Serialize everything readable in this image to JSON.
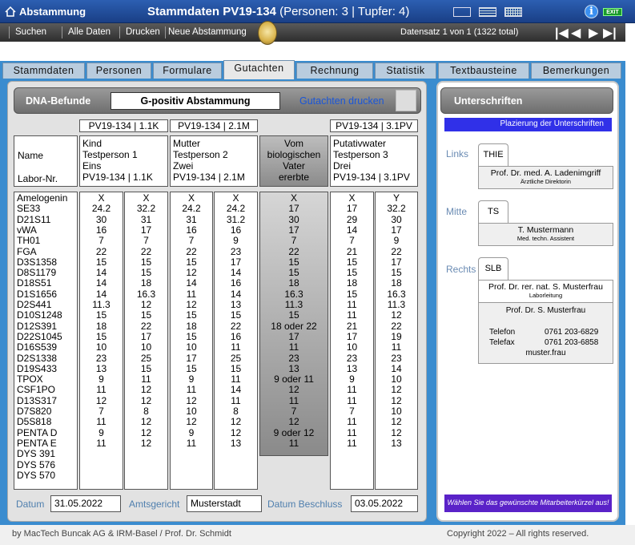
{
  "titlebar": {
    "home_label": "Abstammung",
    "title": "Stammdaten PV19-134",
    "subtitle": "(Personen: 3  |  Tupfer: 4)",
    "exit": "EXIT",
    "info": "i"
  },
  "toolbar": {
    "suchen": "Suchen",
    "alle": "Alle Daten",
    "drucken": "Drucken",
    "neu": "Neue Abstammung",
    "record": "Datensatz 1 von 1 (1322 total)"
  },
  "tabs": [
    "Stammdaten",
    "Personen",
    "Formulare",
    "Gutachten",
    "Rechnung",
    "Statistik",
    "Textbausteine",
    "Bemerkungen"
  ],
  "dna": {
    "label": "DNA-Befunde",
    "value": "G-positiv Abstammung",
    "print": "Gutachten drucken"
  },
  "refs": {
    "kind": "PV19-134 | 1.1K",
    "mutter": "PV19-134 | 2.1M",
    "putativ": "PV19-134 | 3.1PV"
  },
  "heads": {
    "name_lbl": "Name",
    "labor_lbl": "Labor-Nr.",
    "kind": [
      "Kind",
      "Testperson 1",
      "Eins",
      "PV19-134 | 1.1K"
    ],
    "mutter": [
      "Mutter",
      "Testperson 2",
      "Zwei",
      "PV19-134 | 2.1M"
    ],
    "vater": [
      "Vom",
      "biologischen",
      "Vater",
      "ererbte"
    ],
    "putativ": [
      "Putativwater",
      "Testperson 3",
      "Drei",
      "PV19-134 | 3.1PV"
    ]
  },
  "loci": [
    "Amelogenin",
    "SE33",
    "D21S11",
    "vWA",
    "TH01",
    "FGA",
    "D3S1358",
    "D8S1179",
    "D18S51",
    "D1S1656",
    "D2S441",
    "D10S1248",
    "D12S391",
    "D22S1045",
    "D16S539",
    "D2S1338",
    "D19S433",
    "TPOX",
    "CSF1PO",
    "D13S317",
    "D7S820",
    "D5S818",
    "PENTA D",
    "PENTA E",
    "DYS 391",
    "DYS 576",
    "DYS 570"
  ],
  "kind1": [
    "X",
    "24.2",
    "30",
    "16",
    "7",
    "22",
    "15",
    "14",
    "14",
    "14",
    "11.3",
    "15",
    "18",
    "15",
    "10",
    "23",
    "13",
    "9",
    "11",
    "12",
    "7",
    "11",
    "9",
    "11",
    "",
    "",
    ""
  ],
  "kind2": [
    "X",
    "32.2",
    "31",
    "17",
    "7",
    "22",
    "15",
    "15",
    "18",
    "16.3",
    "12",
    "15",
    "22",
    "17",
    "10",
    "25",
    "15",
    "11",
    "12",
    "12",
    "8",
    "12",
    "12",
    "12",
    "",
    "",
    ""
  ],
  "mutter1": [
    "X",
    "24.2",
    "31",
    "16",
    "7",
    "22",
    "15",
    "12",
    "14",
    "11",
    "12",
    "15",
    "18",
    "15",
    "10",
    "17",
    "15",
    "9",
    "11",
    "12",
    "10",
    "12",
    "9",
    "11",
    "",
    "",
    ""
  ],
  "mutter2": [
    "X",
    "24.2",
    "31.2",
    "16",
    "9",
    "23",
    "17",
    "14",
    "16",
    "14",
    "13",
    "15",
    "22",
    "16",
    "11",
    "25",
    "15",
    "11",
    "14",
    "11",
    "8",
    "12",
    "12",
    "13",
    "",
    "",
    ""
  ],
  "vater": [
    "X",
    "17",
    "30",
    "17",
    "7",
    "22",
    "15",
    "15",
    "18",
    "16.3",
    "11.3",
    "15",
    "18 oder 22",
    "17",
    "11",
    "23",
    "13",
    "9 oder 11",
    "12",
    "11",
    "7",
    "12",
    "9 oder 12",
    "11"
  ],
  "putativ1": [
    "X",
    "17",
    "29",
    "14",
    "7",
    "21",
    "15",
    "15",
    "18",
    "15",
    "11",
    "11",
    "21",
    "17",
    "10",
    "23",
    "13",
    "9",
    "11",
    "11",
    "7",
    "11",
    "11",
    "11",
    "",
    "",
    ""
  ],
  "putativ2": [
    "Y",
    "32.2",
    "30",
    "17",
    "9",
    "22",
    "17",
    "15",
    "18",
    "16.3",
    "11.3",
    "12",
    "22",
    "19",
    "11",
    "23",
    "14",
    "10",
    "12",
    "12",
    "10",
    "12",
    "12",
    "13",
    "",
    "",
    ""
  ],
  "bottom": {
    "datum_lbl": "Datum",
    "datum": "31.05.2022",
    "gericht_lbl": "Amtsgericht",
    "gericht": "Musterstadt",
    "beschluss_lbl": "Datum Beschluss",
    "beschluss": "03.05.2022"
  },
  "right": {
    "title": "Unterschriften",
    "placement": "Plazierung der Unterschriften",
    "links": "Links",
    "mitte": "Mitte",
    "rechts": "Rechts",
    "links_tag": "THIE",
    "links_name": "Prof. Dr. med. A. Ladenimgriff",
    "links_role": "Ärztliche Direktorin",
    "mitte_tag": "TS",
    "mitte_name": "T. Mustermann",
    "mitte_role": "Med. techn. Assistent",
    "rechts_tag": "SLB",
    "rechts_name": "Prof. Dr. rer. nat. S. Musterfrau",
    "rechts_role": "Laborleitung",
    "addr_name": "Prof. Dr. S. Musterfrau",
    "tel_lbl": "Telefon",
    "tel": "0761 203-6829",
    "fax_lbl": "Telefax",
    "fax": "0761 203-6858",
    "mail": "muster.frau",
    "hint": "Wählen Sie das gewünschte Mitarbeiterkürzel aus!"
  },
  "footer": {
    "left": "by MacTech Buncak AG & IRM-Basel / Prof. Dr. Schmidt",
    "right": "Copyright 2022 – All rights reserved."
  }
}
